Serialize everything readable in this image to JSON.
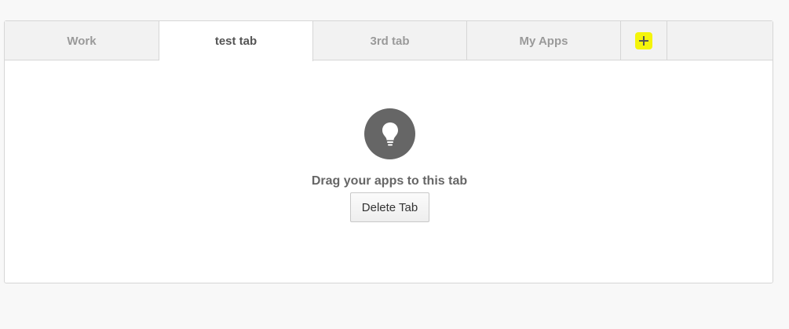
{
  "tabs": [
    {
      "label": "Work",
      "active": false
    },
    {
      "label": "test tab",
      "active": true
    },
    {
      "label": "3rd tab",
      "active": false
    },
    {
      "label": "My Apps",
      "active": false
    }
  ],
  "add_tab": {
    "icon": "plus-icon",
    "highlight_color": "#f4f40a"
  },
  "empty_state": {
    "icon": "lightbulb-icon",
    "message": "Drag your apps to this tab",
    "delete_button_label": "Delete Tab"
  },
  "colors": {
    "page_background": "#f8f8f8",
    "tab_bar_background": "#f2f2f2",
    "icon_circle": "#666666"
  }
}
